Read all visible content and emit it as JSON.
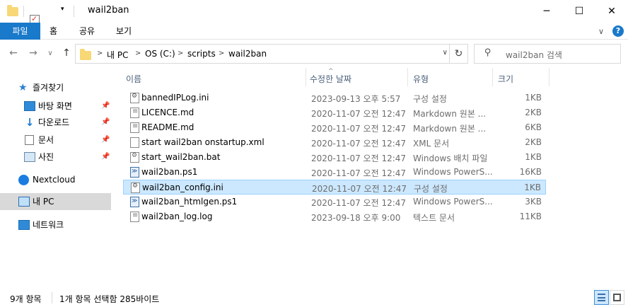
{
  "window": {
    "title": "wail2ban",
    "minimize_icon": "minimize-icon",
    "maximize_icon": "maximize-icon",
    "close_icon": "close-icon"
  },
  "ribbon": {
    "tabs": [
      {
        "label": "파일"
      },
      {
        "label": "홈"
      },
      {
        "label": "공유"
      },
      {
        "label": "보기"
      }
    ],
    "expand_glyph": "∨",
    "help_glyph": "?"
  },
  "nav": {
    "back_glyph": "←",
    "forward_glyph": "→",
    "recent_glyph": "∨",
    "up_glyph": "↑",
    "breadcrumb": [
      "내 PC",
      "OS (C:)",
      "scripts",
      "wail2ban"
    ],
    "crumb_sep": ">",
    "dropdown_glyph": "∨",
    "refresh_glyph": "↻",
    "search_placeholder": "wail2ban 검색",
    "search_glyph": "⚲"
  },
  "sidebar": {
    "items": [
      {
        "label": "즐겨찾기",
        "icon": "star-icon"
      },
      {
        "label": "바탕 화면",
        "icon": "desktop-icon",
        "pinned": true
      },
      {
        "label": "다운로드",
        "icon": "download-icon",
        "pinned": true
      },
      {
        "label": "문서",
        "icon": "documents-icon",
        "pinned": true
      },
      {
        "label": "사진",
        "icon": "pictures-icon",
        "pinned": true
      },
      {
        "label": "Nextcloud",
        "icon": "nextcloud-icon"
      },
      {
        "label": "내 PC",
        "icon": "pc-icon"
      },
      {
        "label": "네트워크",
        "icon": "network-icon"
      }
    ],
    "pin_glyph": "📌"
  },
  "columns": {
    "name": "이름",
    "date": "수정한 날짜",
    "type": "유형",
    "size": "크기",
    "sort_glyph": "^"
  },
  "files": [
    {
      "name": "bannedIPLog.ini",
      "date": "2023-09-13 오후 5:57",
      "type": "구성 설정",
      "size": "1KB",
      "kind": "ini"
    },
    {
      "name": "LICENCE.md",
      "date": "2020-11-07 오전 12:47",
      "type": "Markdown 원본 ...",
      "size": "2KB",
      "kind": "md"
    },
    {
      "name": "README.md",
      "date": "2020-11-07 오전 12:47",
      "type": "Markdown 원본 ...",
      "size": "6KB",
      "kind": "md"
    },
    {
      "name": "start wail2ban onstartup.xml",
      "date": "2020-11-07 오전 12:47",
      "type": "XML 문서",
      "size": "2KB",
      "kind": "xml"
    },
    {
      "name": "start_wail2ban.bat",
      "date": "2020-11-07 오전 12:47",
      "type": "Windows 배치 파일",
      "size": "1KB",
      "kind": "bat"
    },
    {
      "name": "wail2ban.ps1",
      "date": "2020-11-07 오전 12:47",
      "type": "Windows PowerS...",
      "size": "16KB",
      "kind": "ps1"
    },
    {
      "name": "wail2ban_config.ini",
      "date": "2020-11-07 오전 12:47",
      "type": "구성 설정",
      "size": "1KB",
      "kind": "ini",
      "selected": true
    },
    {
      "name": "wail2ban_htmlgen.ps1",
      "date": "2020-11-07 오전 12:47",
      "type": "Windows PowerS...",
      "size": "3KB",
      "kind": "ps1"
    },
    {
      "name": "wail2ban_log.log",
      "date": "2023-09-18 오후 9:00",
      "type": "텍스트 문서",
      "size": "11KB",
      "kind": "txt"
    }
  ],
  "status": {
    "item_count": "9개 항목",
    "selection": "1개 항목 선택함 285바이트"
  },
  "colors": {
    "accent": "#1979ca",
    "selection_bg": "#cce8ff",
    "selection_border": "#99d1ff"
  }
}
